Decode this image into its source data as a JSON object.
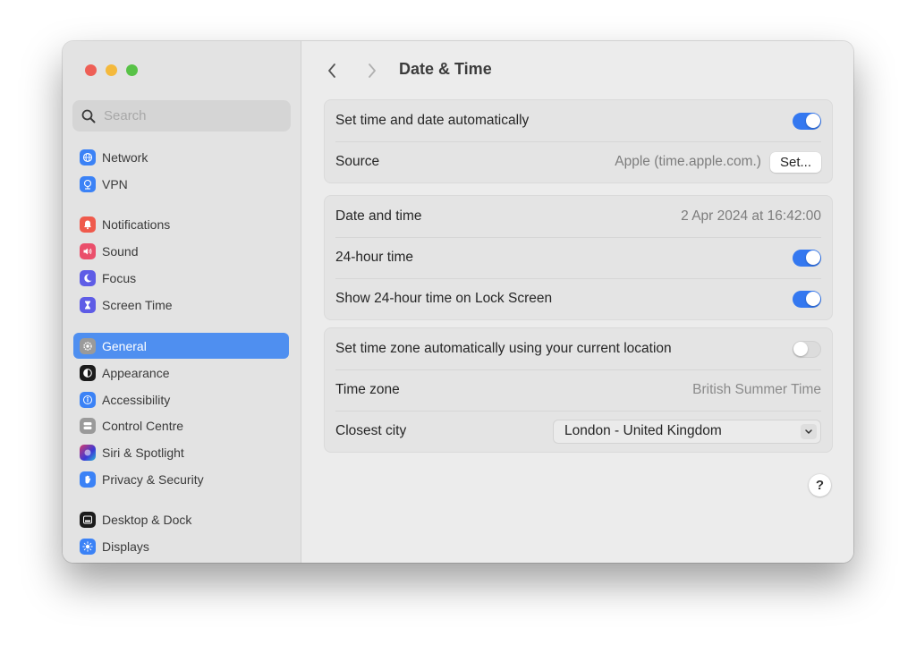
{
  "window": {
    "title": "Date & Time"
  },
  "sidebar": {
    "search_placeholder": "Search",
    "items": [
      {
        "label": "Network",
        "icon": "globe-icon",
        "color": "#3b82f6"
      },
      {
        "label": "VPN",
        "icon": "vpn-globe-icon",
        "color": "#3b82f6"
      },
      {
        "label": "Notifications",
        "icon": "bell-icon",
        "color": "#ef5a4c"
      },
      {
        "label": "Sound",
        "icon": "speaker-icon",
        "color": "#ea4f6b"
      },
      {
        "label": "Focus",
        "icon": "moon-icon",
        "color": "#5e5ce6"
      },
      {
        "label": "Screen Time",
        "icon": "hourglass-icon",
        "color": "#5e5ce6"
      },
      {
        "label": "General",
        "icon": "gear-icon",
        "color": "#9a9a9a",
        "selected": true
      },
      {
        "label": "Appearance",
        "icon": "appearance-icon",
        "color": "#1c1c1c"
      },
      {
        "label": "Accessibility",
        "icon": "accessibility-icon",
        "color": "#3b82f6"
      },
      {
        "label": "Control Centre",
        "icon": "control-centre-icon",
        "color": "#9a9a9a"
      },
      {
        "label": "Siri & Spotlight",
        "icon": "siri-icon",
        "color": "#8c3b9e"
      },
      {
        "label": "Privacy & Security",
        "icon": "hand-icon",
        "color": "#3b82f6"
      },
      {
        "label": "Desktop & Dock",
        "icon": "dock-icon",
        "color": "#1c1c1c"
      },
      {
        "label": "Displays",
        "icon": "sun-icon",
        "color": "#3b82f6"
      }
    ]
  },
  "main": {
    "title": "Date & Time",
    "groups": [
      {
        "rows": [
          {
            "label": "Set time and date automatically",
            "toggle": true
          },
          {
            "label": "Source",
            "value": "Apple (time.apple.com.)",
            "button": "Set..."
          }
        ]
      },
      {
        "rows": [
          {
            "label": "Date and time",
            "value": "2 Apr 2024 at 16:42:00"
          },
          {
            "label": "24-hour time",
            "toggle": true
          },
          {
            "label": "Show 24-hour time on Lock Screen",
            "toggle": true
          }
        ]
      },
      {
        "rows": [
          {
            "label": "Set time zone automatically using your current location",
            "toggle": false
          },
          {
            "label": "Time zone",
            "value": "British Summer Time"
          },
          {
            "label": "Closest city",
            "select": "London - United Kingdom"
          }
        ]
      }
    ],
    "help_label": "?"
  },
  "colors": {
    "accent": "#3478f0",
    "selection": "#4f8ff0"
  }
}
